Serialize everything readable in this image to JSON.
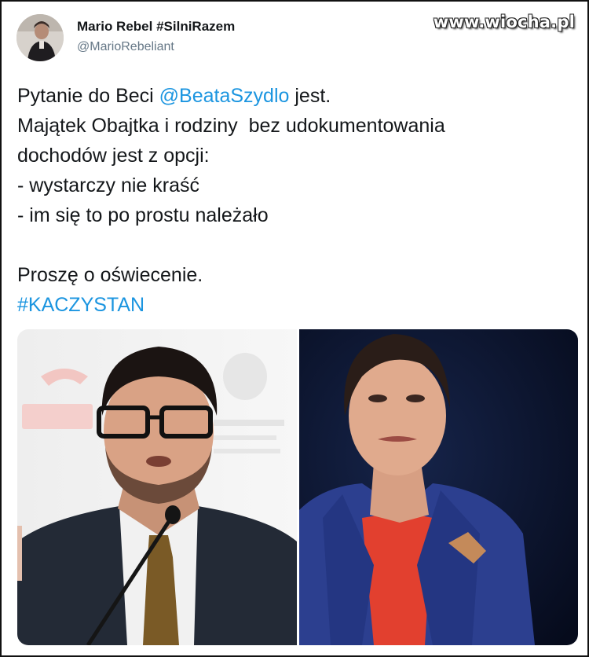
{
  "tweet": {
    "author": {
      "display_name": "Mario Rebel #SilniRazem",
      "handle": "@MarioRebeliant",
      "avatar_icon": "user-avatar"
    },
    "text": {
      "line1_prefix": "Pytanie do Beci ",
      "line1_mention": "@BeataSzydlo",
      "line1_suffix": " jest.",
      "line2": "Majątek Obajtka i rodziny  bez udokumentowania",
      "line3": "dochodów jest z opcji:",
      "line4": "- wystarczy nie kraść",
      "line5": "- im się to po prostu należało",
      "line6": "Proszę o oświecenie.",
      "hashtag": "#KACZYSTAN"
    },
    "media": [
      {
        "name": "photo-man-at-microphone"
      },
      {
        "name": "photo-woman-blue-jacket"
      }
    ]
  },
  "watermark": "www.wiocha.pl",
  "colors": {
    "link": "#1b95e0",
    "text": "#14171a",
    "secondary": "#657786"
  }
}
